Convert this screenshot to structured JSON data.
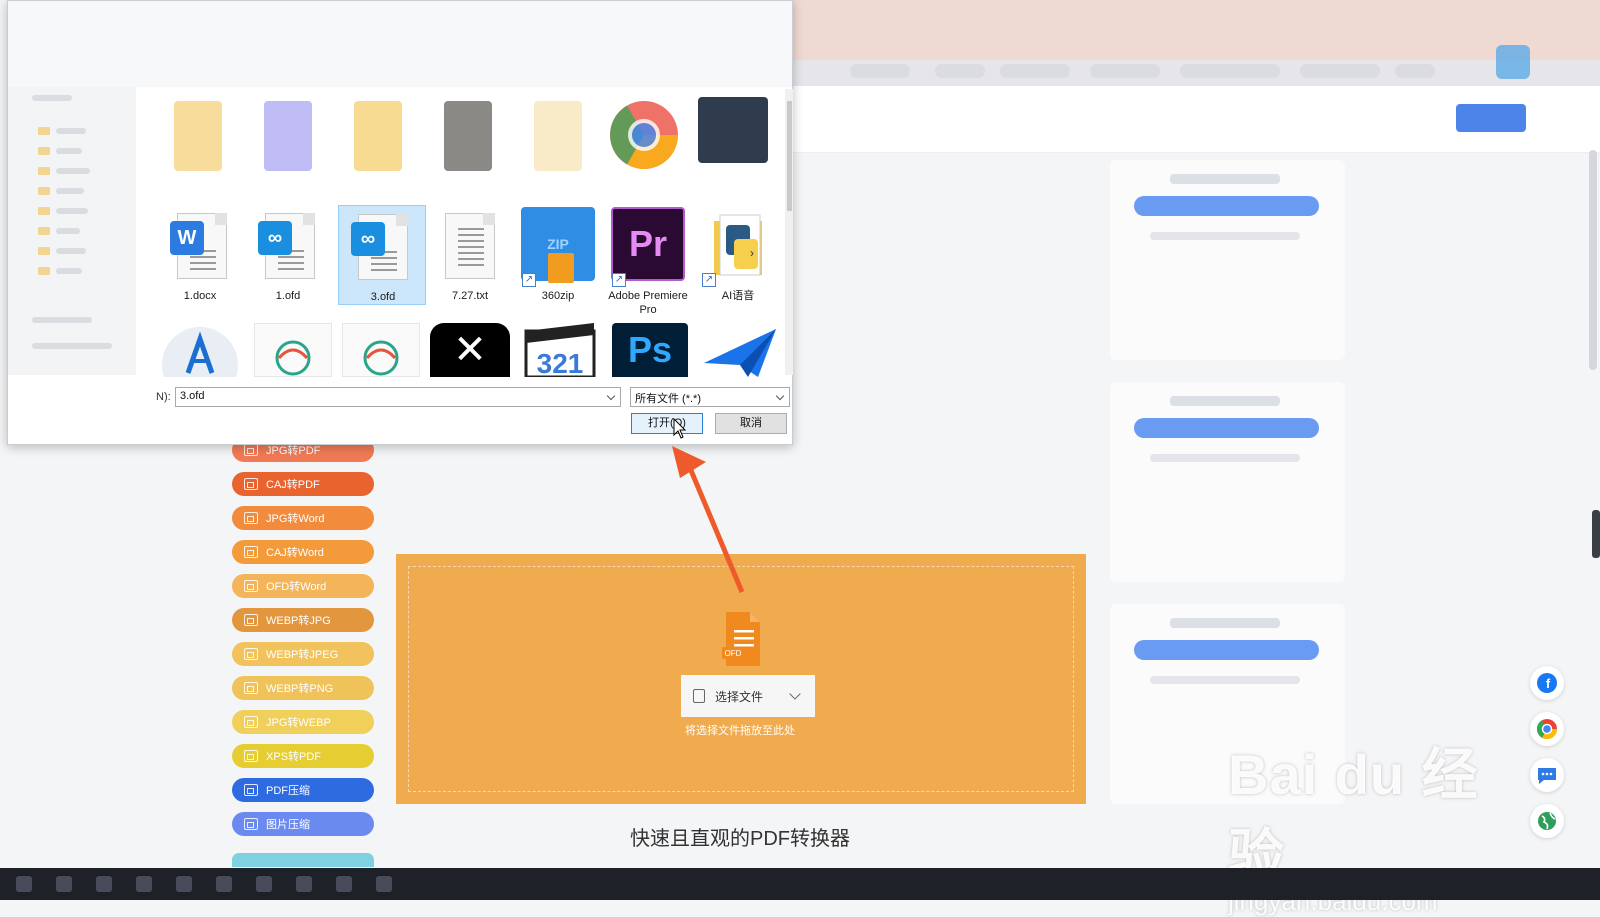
{
  "dialog": {
    "files_row2": [
      {
        "name": "1.docx"
      },
      {
        "name": "1.ofd"
      },
      {
        "name": "3.ofd"
      },
      {
        "name": "7.27.txt"
      },
      {
        "name": "360zip"
      },
      {
        "name": "Adobe Premiere Pro"
      },
      {
        "name": "AI语音"
      }
    ],
    "filename_label": "N):",
    "filename_value": "3.ofd",
    "filetype_value": "所有文件 (*.*)",
    "open_label": "打开(O)",
    "cancel_label": "取消",
    "badges": {
      "word": "W",
      "ofd": "∞",
      "zip": "ZIP",
      "pr": "Pr",
      "ps": "Ps"
    }
  },
  "sidebar": {
    "items": [
      {
        "label": "JPG转PDF",
        "color": "#f07a55"
      },
      {
        "label": "CAJ转PDF",
        "color": "#e9632f"
      },
      {
        "label": "JPG转Word",
        "color": "#f28b3c"
      },
      {
        "label": "CAJ转Word",
        "color": "#f39a3a"
      },
      {
        "label": "OFD转Word",
        "color": "#f4b45a"
      },
      {
        "label": "WEBP转JPG",
        "color": "#e2963e"
      },
      {
        "label": "WEBP转JPEG",
        "color": "#f2c35c"
      },
      {
        "label": "WEBP转PNG",
        "color": "#efc25a"
      },
      {
        "label": "JPG转WEBP",
        "color": "#f0cf5a"
      },
      {
        "label": "XPS转PDF",
        "color": "#e6cd31"
      },
      {
        "label": "PDF压缩",
        "color": "#2f6be0"
      },
      {
        "label": "图片压缩",
        "color": "#6b8af0"
      }
    ]
  },
  "dropzone": {
    "ofd_tag": "OFD",
    "choose_label": "选择文件",
    "hint": "将选择文件拖放至此处"
  },
  "main_title": "快速且直观的PDF转换器",
  "watermark": {
    "main": "Bai du 经验",
    "sub": "jingyan.baidu.com"
  },
  "colors": {
    "accent_blue": "#2e6ee6",
    "drop_orange": "#f0ab4f",
    "arrow_red": "#ef5a2b"
  }
}
